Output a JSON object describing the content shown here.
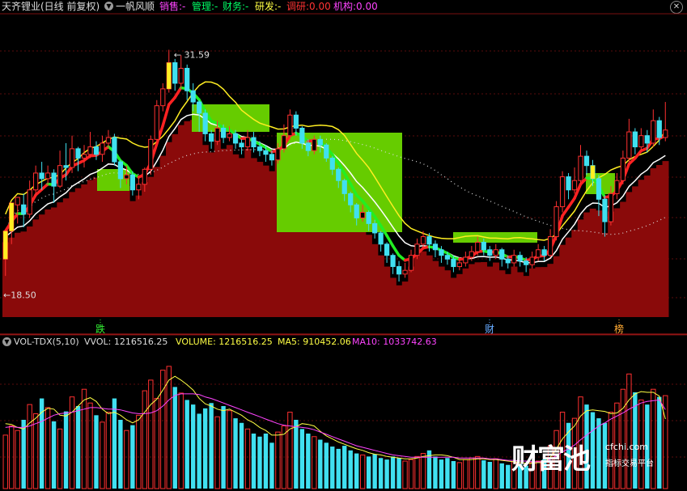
{
  "header": {
    "stock_name": "天齐锂业(日线 前复权)",
    "indicator_name": "一帆风顺",
    "items": [
      {
        "label": "销售:",
        "value": "-",
        "color": "#ff44ff"
      },
      {
        "label": "管理:",
        "value": "-",
        "color": "#00ff66"
      },
      {
        "label": "财务:",
        "value": "-",
        "color": "#00ff66"
      },
      {
        "label": "研发:",
        "value": "-",
        "color": "#ffff44"
      },
      {
        "label": "调研:",
        "value": "0.00",
        "color": "#ff3333"
      },
      {
        "label": "机构:",
        "value": "0.00",
        "color": "#ff44ff"
      }
    ],
    "close_icon": "x-icon"
  },
  "price_markers": {
    "high": "31.59",
    "low": "18.50"
  },
  "event_markers": [
    {
      "label": "跌",
      "color": "#33ee33"
    },
    {
      "label": "财",
      "color": "#66aaff"
    },
    {
      "label": "榜",
      "color": "#ffaa33"
    }
  ],
  "volume_header": {
    "title": "VOL-TDX(5,10)",
    "vvol": "VVOL: 1216516.25",
    "volume": "VOLUME: 1216516.25",
    "ma5": "MA5: 910452.06",
    "ma10": "MA10: 1033742.63",
    "colors": {
      "title": "#dddddd",
      "vvol": "#dddddd",
      "volume": "#ffff44",
      "ma5": "#ffff44",
      "ma10": "#ff44ff"
    }
  },
  "watermark": {
    "big": "财富池",
    "site": "cfchi.com",
    "sub": "指标交易平台"
  },
  "chart_data": {
    "type": "candlestick",
    "price_high_label": 31.59,
    "price_low_label": 18.5,
    "ylim_price": [
      17.3,
      33.3
    ],
    "candles": [
      [
        20.4,
        21.9,
        21.8,
        19.5
      ],
      [
        21.9,
        23.4,
        23.3,
        21.2
      ],
      [
        23.3,
        23.7,
        23.3,
        22.3
      ],
      [
        23.3,
        22.8,
        23.9,
        22.1
      ],
      [
        22.8,
        24.1,
        24.6,
        22.6
      ],
      [
        24.1,
        25.0,
        25.4,
        23.7
      ],
      [
        25.0,
        24.7,
        25.6,
        24.1
      ],
      [
        24.7,
        25.0,
        25.4,
        24.3
      ],
      [
        25.0,
        24.3,
        25.2,
        23.4
      ],
      [
        24.3,
        25.4,
        26.2,
        24.2
      ],
      [
        25.4,
        25.3,
        26.6,
        24.6
      ],
      [
        25.3,
        26.3,
        27.0,
        25.0
      ],
      [
        26.3,
        25.8,
        26.4,
        25.1
      ],
      [
        25.8,
        26.0,
        26.5,
        25.3
      ],
      [
        26.0,
        26.4,
        27.2,
        25.8
      ],
      [
        26.4,
        26.0,
        26.7,
        25.7
      ],
      [
        26.0,
        26.6,
        27.0,
        25.6
      ],
      [
        26.6,
        26.9,
        27.3,
        26.3
      ],
      [
        26.9,
        25.6,
        27.1,
        25.4
      ],
      [
        25.6,
        24.7,
        25.7,
        24.2
      ],
      [
        24.7,
        24.9,
        25.4,
        24.4
      ],
      [
        24.9,
        24.1,
        25.1,
        23.8
      ],
      [
        24.1,
        24.4,
        24.7,
        23.6
      ],
      [
        24.4,
        25.2,
        25.3,
        24.0
      ],
      [
        25.2,
        26.8,
        27.0,
        24.9
      ],
      [
        26.8,
        28.6,
        28.9,
        26.6
      ],
      [
        28.6,
        29.5,
        29.8,
        28.3
      ],
      [
        29.5,
        30.9,
        31.59,
        29.3
      ],
      [
        30.9,
        29.8,
        31.1,
        29.4
      ],
      [
        29.8,
        30.6,
        31.3,
        29.5
      ],
      [
        30.6,
        29.4,
        30.8,
        28.9
      ],
      [
        29.4,
        28.8,
        29.8,
        28.3
      ],
      [
        28.8,
        28.2,
        28.9,
        27.2
      ],
      [
        28.2,
        27.1,
        28.4,
        26.7
      ],
      [
        27.1,
        26.7,
        27.3,
        26.3
      ],
      [
        26.7,
        27.4,
        27.8,
        26.5
      ],
      [
        27.4,
        26.9,
        27.6,
        26.6
      ],
      [
        26.9,
        27.1,
        27.5,
        26.7
      ],
      [
        27.1,
        26.6,
        27.3,
        26.3
      ],
      [
        26.6,
        26.4,
        26.8,
        26.0
      ],
      [
        26.4,
        26.9,
        27.3,
        26.2
      ],
      [
        26.9,
        26.4,
        27.2,
        26.1
      ],
      [
        26.4,
        26.2,
        26.7,
        25.9
      ],
      [
        26.2,
        26.0,
        26.5,
        25.6
      ],
      [
        26.0,
        25.7,
        26.2,
        25.4
      ],
      [
        25.7,
        26.3,
        26.6,
        25.5
      ],
      [
        26.3,
        27.0,
        27.6,
        26.1
      ],
      [
        27.0,
        28.1,
        28.4,
        26.8
      ],
      [
        28.1,
        27.4,
        28.3,
        27.0
      ],
      [
        27.4,
        26.6,
        27.5,
        26.3
      ],
      [
        26.6,
        26.2,
        26.8,
        25.9
      ],
      [
        26.2,
        26.8,
        27.0,
        26.0
      ],
      [
        26.8,
        26.5,
        27.0,
        26.1
      ],
      [
        26.5,
        25.8,
        26.6,
        25.6
      ],
      [
        25.8,
        25.2,
        25.9,
        24.9
      ],
      [
        25.2,
        24.6,
        25.3,
        24.2
      ],
      [
        24.6,
        23.9,
        24.7,
        23.5
      ],
      [
        23.9,
        23.3,
        24.0,
        22.9
      ],
      [
        23.3,
        22.6,
        23.4,
        22.2
      ],
      [
        22.6,
        22.9,
        23.3,
        22.4
      ],
      [
        22.9,
        22.3,
        23.0,
        21.9
      ],
      [
        22.3,
        21.8,
        22.5,
        21.5
      ],
      [
        21.8,
        21.2,
        21.9,
        20.8
      ],
      [
        21.2,
        20.6,
        21.3,
        20.2
      ],
      [
        20.6,
        20.0,
        20.7,
        19.6
      ],
      [
        20.0,
        19.6,
        20.3,
        19.2
      ],
      [
        19.6,
        19.8,
        20.2,
        19.4
      ],
      [
        19.8,
        20.6,
        20.9,
        19.7
      ],
      [
        20.6,
        21.2,
        21.5,
        20.4
      ],
      [
        21.2,
        21.6,
        21.9,
        21.0
      ],
      [
        21.6,
        21.2,
        21.8,
        20.8
      ],
      [
        21.2,
        20.9,
        21.4,
        20.5
      ],
      [
        20.9,
        20.6,
        21.1,
        20.2
      ],
      [
        20.6,
        20.4,
        20.8,
        20.1
      ],
      [
        20.4,
        20.0,
        20.6,
        19.7
      ],
      [
        20.0,
        20.2,
        20.5,
        19.8
      ],
      [
        20.2,
        20.5,
        20.8,
        20.0
      ],
      [
        20.5,
        20.8,
        21.1,
        20.3
      ],
      [
        20.8,
        21.3,
        21.6,
        20.6
      ],
      [
        21.3,
        20.9,
        21.5,
        20.6
      ],
      [
        20.9,
        20.6,
        21.1,
        20.3
      ],
      [
        20.6,
        20.9,
        21.2,
        20.4
      ],
      [
        20.9,
        20.4,
        21.0,
        20.0
      ],
      [
        20.4,
        20.2,
        20.6,
        19.9
      ],
      [
        20.2,
        20.6,
        20.9,
        20.0
      ],
      [
        20.6,
        20.3,
        20.8,
        20.0
      ],
      [
        20.3,
        20.1,
        20.5,
        19.7
      ],
      [
        20.1,
        20.5,
        20.8,
        19.9
      ],
      [
        20.5,
        20.9,
        21.2,
        20.3
      ],
      [
        20.9,
        20.6,
        21.1,
        20.3
      ],
      [
        20.6,
        21.6,
        22.0,
        20.5
      ],
      [
        21.6,
        23.2,
        23.5,
        21.4
      ],
      [
        23.2,
        24.8,
        25.1,
        22.9
      ],
      [
        24.8,
        24.1,
        25.0,
        23.6
      ],
      [
        24.1,
        24.6,
        25.3,
        23.9
      ],
      [
        24.6,
        25.9,
        26.5,
        24.4
      ],
      [
        25.9,
        25.4,
        26.2,
        24.9
      ],
      [
        25.4,
        24.7,
        25.7,
        24.3
      ],
      [
        24.7,
        23.6,
        24.9,
        22.7
      ],
      [
        23.6,
        22.4,
        23.8,
        21.6
      ],
      [
        22.4,
        23.9,
        24.3,
        22.2
      ],
      [
        23.9,
        24.6,
        25.0,
        23.6
      ],
      [
        24.6,
        25.8,
        26.2,
        24.4
      ],
      [
        25.8,
        27.2,
        27.9,
        25.6
      ],
      [
        27.2,
        26.4,
        27.4,
        26.0
      ],
      [
        26.4,
        27.0,
        27.4,
        26.2
      ],
      [
        27.0,
        26.6,
        27.3,
        26.1
      ],
      [
        26.6,
        27.8,
        28.4,
        26.4
      ],
      [
        27.8,
        26.9,
        28.0,
        26.5
      ],
      [
        26.9,
        27.3,
        28.8,
        26.7
      ]
    ],
    "volume": {
      "ylim": [
        0,
        1800000
      ],
      "values": [
        700000,
        820000,
        760000,
        900000,
        1100000,
        980000,
        1180000,
        1060000,
        880000,
        780000,
        1010000,
        1200000,
        1080000,
        1300000,
        1120000,
        960000,
        870000,
        1000000,
        1180000,
        900000,
        760000,
        830000,
        960000,
        1280000,
        1420000,
        1180000,
        1550000,
        1600000,
        1330000,
        1250000,
        1160000,
        1100000,
        980000,
        1050000,
        1120000,
        940000,
        1080000,
        1020000,
        920000,
        860000,
        780000,
        720000,
        680000,
        720000,
        600000,
        740000,
        820000,
        1000000,
        900000,
        780000,
        720000,
        680000,
        640000,
        600000,
        550000,
        520000,
        560000,
        500000,
        460000,
        440000,
        420000,
        450000,
        400000,
        380000,
        420000,
        400000,
        360000,
        380000,
        420000,
        460000,
        500000,
        420000,
        380000,
        400000,
        360000,
        340000,
        380000,
        400000,
        420000,
        370000,
        350000,
        390000,
        330000,
        310000,
        350000,
        320000,
        300000,
        340000,
        360000,
        380000,
        560000,
        760000,
        1000000,
        860000,
        920000,
        1200000,
        1100000,
        1000000,
        920000,
        860000,
        1000000,
        1120000,
        1300000,
        1500000,
        1260000,
        1160000,
        1100000,
        1300000,
        1200000,
        1216516.25
      ],
      "ma5": [
        850000,
        840000,
        800000,
        780000,
        860000,
        920000,
        1000000,
        1050000,
        1040000,
        960000,
        950000,
        1000000,
        1080000,
        1160000,
        1190000,
        1140000,
        1040000,
        980000,
        1000000,
        960000,
        900000,
        860000,
        900000,
        1000000,
        1100000,
        1170000,
        1290000,
        1420000,
        1470000,
        1420000,
        1360000,
        1290000,
        1180000,
        1110000,
        1080000,
        1040000,
        1020000,
        1040000,
        1000000,
        960000,
        900000,
        860000,
        800000,
        760000,
        700000,
        700000,
        710000,
        780000,
        810000,
        850000,
        840000,
        820000,
        750000,
        690000,
        650000,
        610000,
        580000,
        550000,
        520000,
        500000,
        470000,
        450000,
        440000,
        420000,
        410000,
        400000,
        390000,
        390000,
        400000,
        420000,
        430000,
        440000,
        440000,
        430000,
        410000,
        380000,
        380000,
        380000,
        390000,
        390000,
        380000,
        380000,
        370000,
        360000,
        350000,
        340000,
        330000,
        330000,
        340000,
        340000,
        410000,
        520000,
        650000,
        740000,
        820000,
        950000,
        1020000,
        1030000,
        1020000,
        1010000,
        980000,
        990000,
        1050000,
        1160000,
        1240000,
        1270000,
        1260000,
        1260000,
        1210000,
        910452.06
      ],
      "ma10": [
        800000,
        810000,
        800000,
        800000,
        820000,
        850000,
        880000,
        920000,
        960000,
        980000,
        990000,
        1000000,
        1020000,
        1040000,
        1060000,
        1060000,
        1050000,
        1040000,
        1040000,
        1030000,
        1010000,
        990000,
        980000,
        980000,
        990000,
        1020000,
        1080000,
        1160000,
        1220000,
        1240000,
        1240000,
        1240000,
        1230000,
        1200000,
        1180000,
        1150000,
        1120000,
        1090000,
        1060000,
        1030000,
        1000000,
        970000,
        940000,
        910000,
        880000,
        850000,
        830000,
        820000,
        810000,
        800000,
        790000,
        770000,
        740000,
        710000,
        680000,
        650000,
        620000,
        590000,
        560000,
        540000,
        520000,
        500000,
        480000,
        460000,
        440000,
        430000,
        420000,
        410000,
        410000,
        410000,
        410000,
        410000,
        410000,
        410000,
        410000,
        400000,
        400000,
        400000,
        400000,
        400000,
        390000,
        390000,
        380000,
        370000,
        370000,
        360000,
        360000,
        350000,
        350000,
        350000,
        380000,
        430000,
        480000,
        520000,
        570000,
        640000,
        700000,
        760000,
        820000,
        860000,
        910000,
        950000,
        990000,
        1040000,
        1080000,
        1120000,
        1140000,
        1150000,
        1160000,
        1033742.63
      ]
    }
  }
}
